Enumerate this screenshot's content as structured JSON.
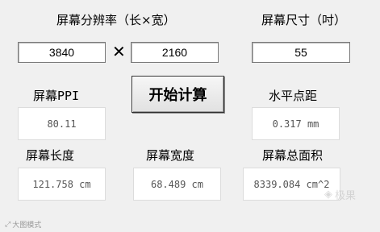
{
  "resolution": {
    "label": "屏幕分辨率（长×宽）",
    "width_value": "3840",
    "times_symbol": "✕",
    "height_value": "2160"
  },
  "size": {
    "label": "屏幕尺寸（吋）",
    "value": "55"
  },
  "calculate_button": "开始计算",
  "ppi": {
    "label": "屏幕PPI",
    "value": "80.11"
  },
  "dot_pitch": {
    "label": "水平点距",
    "value": "0.317 mm"
  },
  "length": {
    "label": "屏幕长度",
    "value": "121.758 cm"
  },
  "width": {
    "label": "屏幕宽度",
    "value": "68.489 cm"
  },
  "area": {
    "label": "屏幕总面积",
    "value": "8339.084 cm^2"
  },
  "watermark_left": "大图模式",
  "watermark_right": "极果"
}
